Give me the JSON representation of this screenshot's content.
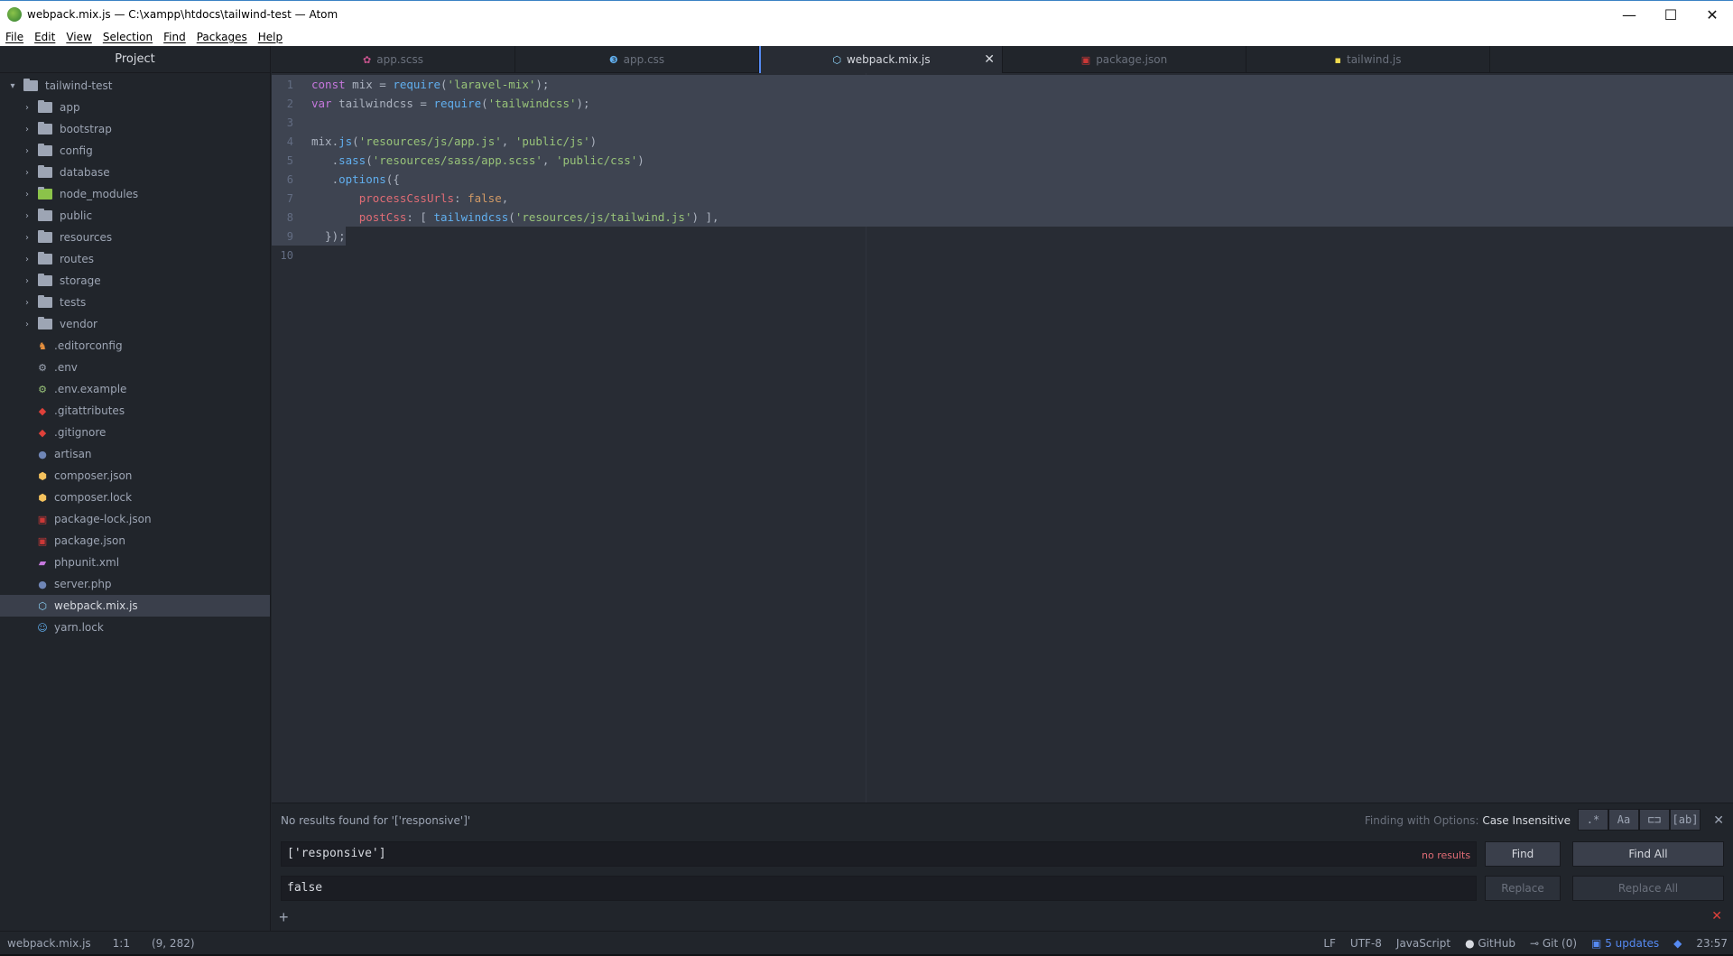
{
  "window": {
    "title": "webpack.mix.js — C:\\xampp\\htdocs\\tailwind-test — Atom",
    "controls": {
      "minimize": "—",
      "maximize": "☐",
      "close": "✕"
    }
  },
  "menu": [
    "File",
    "Edit",
    "View",
    "Selection",
    "Find",
    "Packages",
    "Help"
  ],
  "tree": {
    "header": "Project",
    "root": "tailwind-test",
    "folders": [
      "app",
      "bootstrap",
      "config",
      "database",
      "node_modules",
      "public",
      "resources",
      "routes",
      "storage",
      "tests",
      "vendor"
    ],
    "files": [
      ".editorconfig",
      ".env",
      ".env.example",
      ".gitattributes",
      ".gitignore",
      "artisan",
      "composer.json",
      "composer.lock",
      "package-lock.json",
      "package.json",
      "phpunit.xml",
      "server.php",
      "webpack.mix.js",
      "yarn.lock"
    ],
    "selected": "webpack.mix.js"
  },
  "tabs": [
    {
      "label": "app.scss",
      "icon": "sass-icon",
      "color": "#c6538c"
    },
    {
      "label": "app.css",
      "icon": "css-icon",
      "color": "#61afef"
    },
    {
      "label": "webpack.mix.js",
      "icon": "webpack-icon",
      "color": "#8ed6fb",
      "active": true
    },
    {
      "label": "package.json",
      "icon": "npm-icon",
      "color": "#cb3837"
    },
    {
      "label": "tailwind.js",
      "icon": "js-icon",
      "color": "#f0db4f"
    }
  ],
  "editor": {
    "line_numbers": [
      "1",
      "2",
      "3",
      "4",
      "5",
      "6",
      "7",
      "8",
      "9",
      "10"
    ],
    "lines": [
      "const mix = require('laravel-mix');",
      "var tailwindcss = require('tailwindcss');",
      "",
      "mix.js('resources/js/app.js', 'public/js')",
      "   .sass('resources/sass/app.scss', 'public/css')",
      "   .options({",
      "       processCssUrls: false,",
      "       postCss: [ tailwindcss('resources/js/tailwind.js') ],",
      "  });",
      ""
    ]
  },
  "find": {
    "message": "No results found for '['responsive']'",
    "options_label": "Finding with Options:",
    "options_value": "Case Insensitive",
    "toggles": [
      ".*",
      "Aa",
      "⊏⊐",
      "[ab]"
    ],
    "find_value": "['responsive']",
    "no_results": "no results",
    "replace_value": "false",
    "find_btn": "Find",
    "find_all_btn": "Find All",
    "replace_btn": "Replace",
    "replace_all_btn": "Replace All"
  },
  "status": {
    "file": "webpack.mix.js",
    "cursor": "1:1",
    "selection": "(9, 282)",
    "line_ending": "LF",
    "encoding": "UTF-8",
    "grammar": "JavaScript",
    "github": "GitHub",
    "git": "Git (0)",
    "updates": "5 updates",
    "time": "23:57"
  }
}
